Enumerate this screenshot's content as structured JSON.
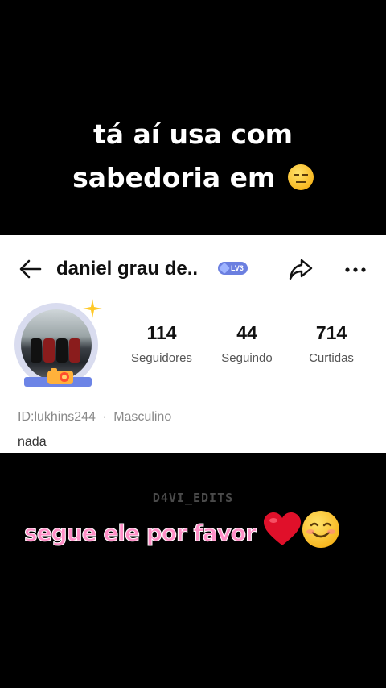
{
  "caption_top": {
    "line1": "tá aí usa com",
    "line2": "sabedoria em"
  },
  "profile": {
    "username": "daniel grau de..",
    "level": "LV3",
    "stats": [
      {
        "value": "114",
        "label": "Seguidores"
      },
      {
        "value": "44",
        "label": "Seguindo"
      },
      {
        "value": "714",
        "label": "Curtidas"
      }
    ],
    "id_text": "ID:lukhins244",
    "separator": "·",
    "gender": "Masculino",
    "bio": "nada"
  },
  "watermark": "D4VI_EDITS",
  "caption_bottom": "segue ele por favor",
  "colors": {
    "caption_pink": "#ff8fc7",
    "badge_blue": "#6b7fe0",
    "heart_red": "#e0102a"
  },
  "icons": [
    "back-arrow-icon",
    "share-icon",
    "more-icon",
    "camera-icon",
    "sparkle-icon",
    "neutral-face-emoji",
    "heart-emoji",
    "smiling-face-emoji"
  ]
}
